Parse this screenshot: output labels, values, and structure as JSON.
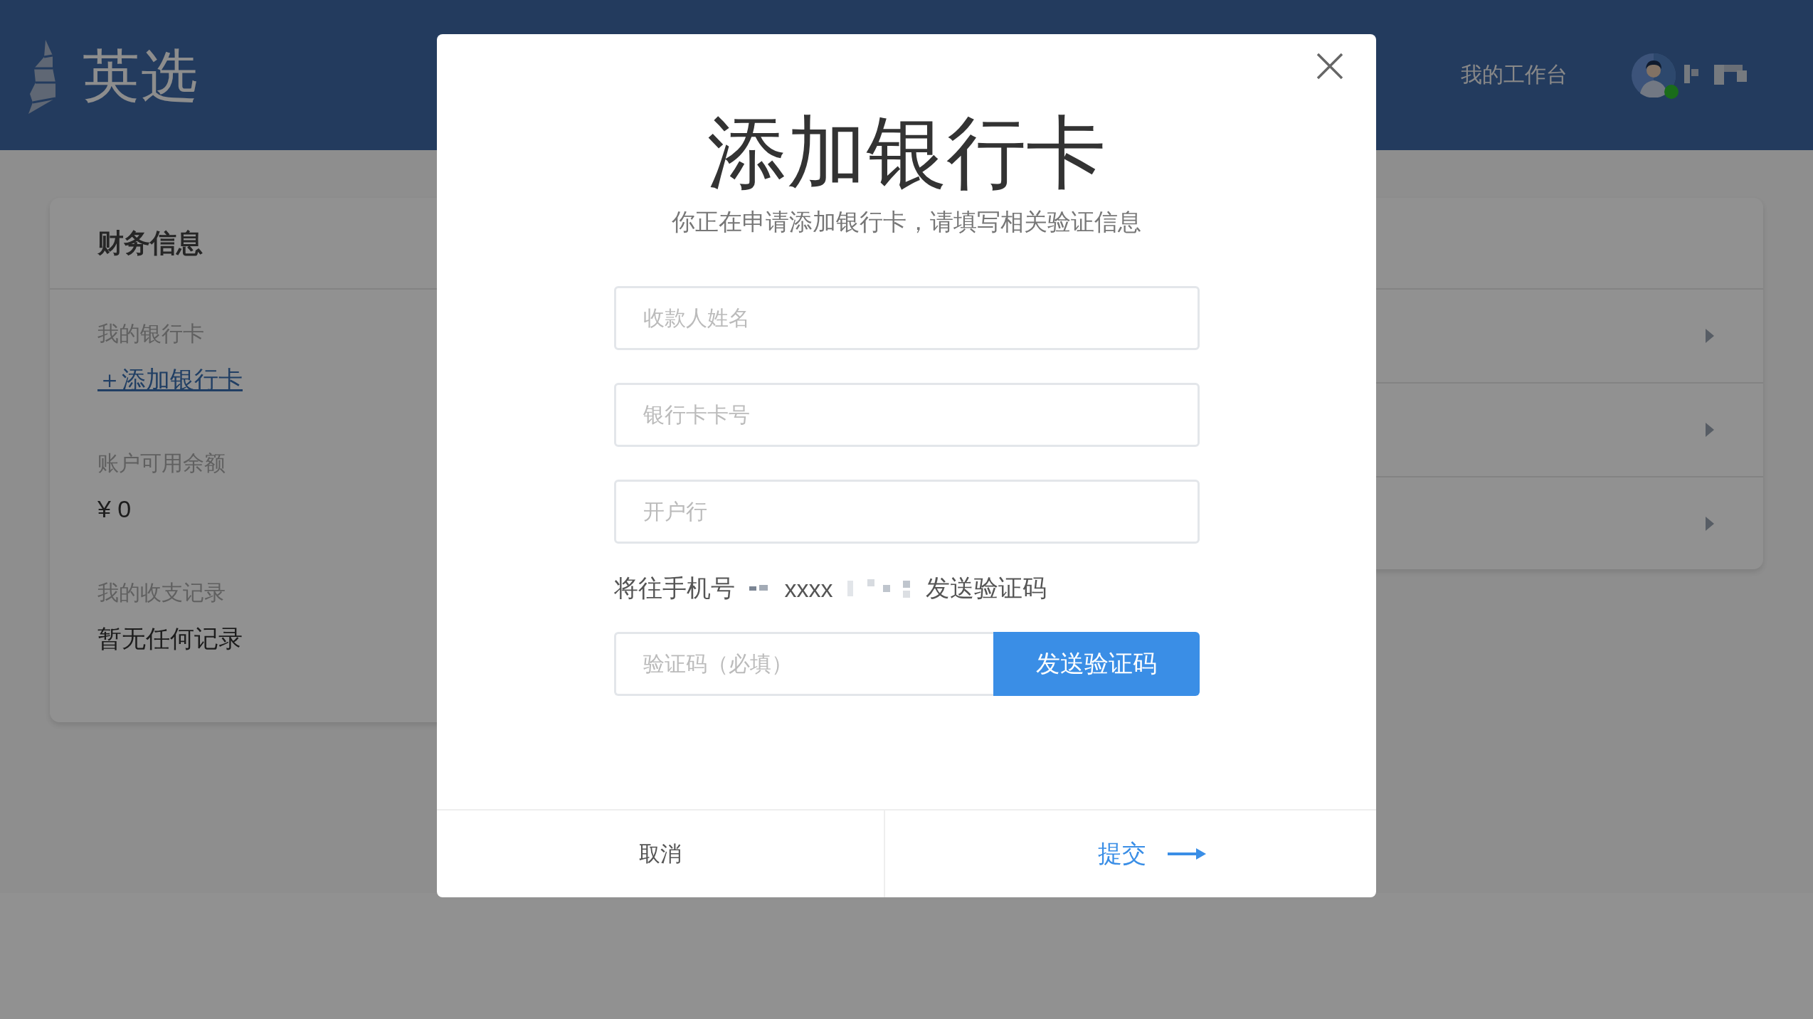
{
  "header": {
    "logo_text": "英选",
    "nav_link": "我的工作台",
    "user": {
      "online": true
    }
  },
  "finance_card": {
    "title": "财务信息",
    "sections": [
      {
        "label": "我的银行卡",
        "value": "＋添加银行卡",
        "kind": "link"
      },
      {
        "label": "账户可用余额",
        "value": "¥ 0",
        "kind": "text"
      },
      {
        "label": "我的收支记录",
        "value": "暂无任何记录",
        "kind": "text"
      }
    ]
  },
  "side_card": {
    "rows": [
      {
        "kind": "arrow"
      },
      {
        "kind": "arrow"
      },
      {
        "kind": "arrow"
      }
    ]
  },
  "modal": {
    "title": "添加银行卡",
    "subtitle": "你正在申请添加银行卡，请填写相关验证信息",
    "fields": [
      {
        "placeholder": "收款人姓名"
      },
      {
        "placeholder": "银行卡卡号"
      },
      {
        "placeholder": "开户行"
      }
    ],
    "phone_notice": {
      "prefix": "将往手机号",
      "masked": "xxxx",
      "suffix": "发送验证码"
    },
    "code_field": {
      "placeholder": "验证码（必填）"
    },
    "send_button": "发送验证码",
    "cancel": "取消",
    "submit": "提交"
  }
}
